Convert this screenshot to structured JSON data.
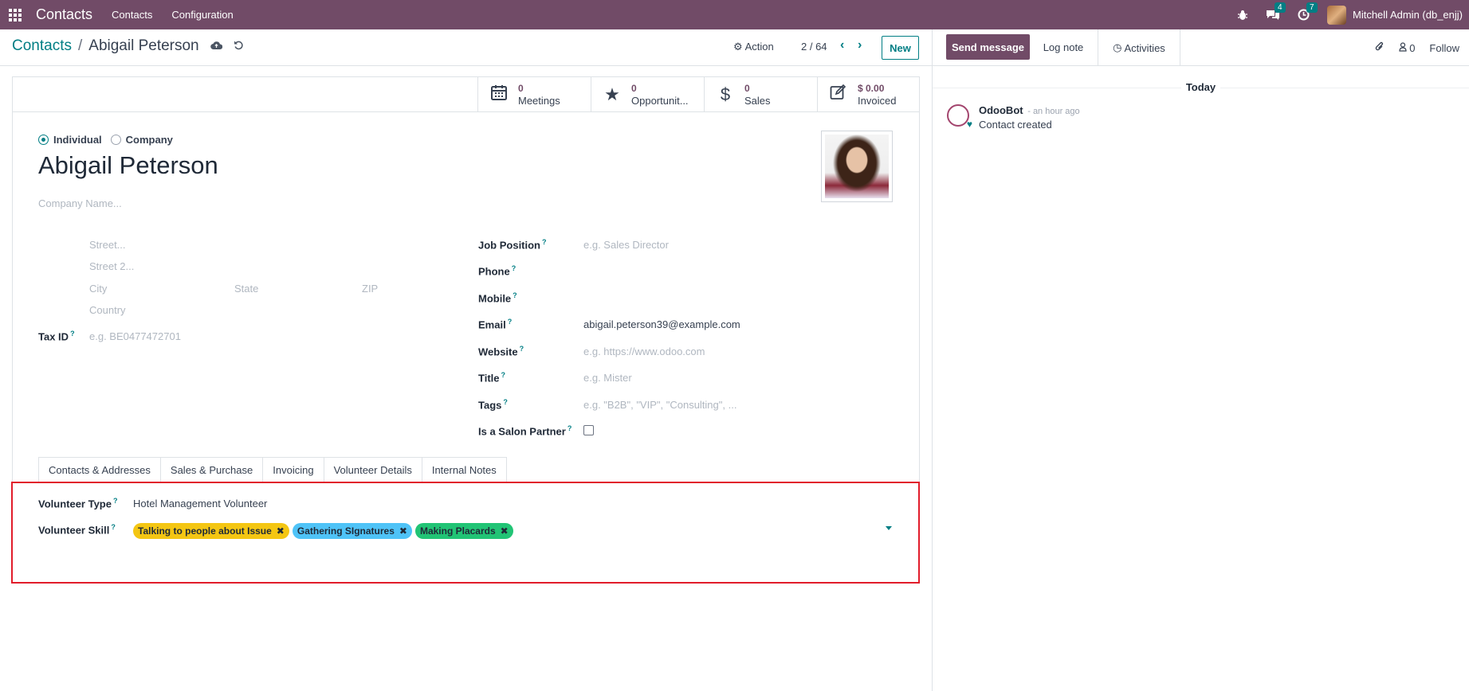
{
  "topbar": {
    "brand": "Contacts",
    "menu": [
      "Contacts",
      "Configuration"
    ],
    "messages_count": "4",
    "activities_count": "7",
    "user": "Mitchell Admin (db_enjj)"
  },
  "control_panel": {
    "breadcrumb_parent": "Contacts",
    "breadcrumb_current": "Abigail Peterson",
    "action_label": "Action",
    "pager": "2 / 64",
    "new_label": "New"
  },
  "smart_buttons": [
    {
      "value": "0",
      "label": "Meetings",
      "icon": "calendar-icon"
    },
    {
      "value": "0",
      "label": "Opportunit...",
      "icon": "star-icon"
    },
    {
      "value": "0",
      "label": "Sales",
      "icon": "dollar-icon"
    },
    {
      "value": "$ 0.00",
      "label": "Invoiced",
      "icon": "edit-icon"
    }
  ],
  "form": {
    "type_individual": "Individual",
    "type_company": "Company",
    "name": "Abigail Peterson",
    "company_placeholder": "Company Name...",
    "street_placeholder": "Street...",
    "street2_placeholder": "Street 2...",
    "city_placeholder": "City",
    "state_placeholder": "State",
    "zip_placeholder": "ZIP",
    "country_placeholder": "Country",
    "tax_label": "Tax ID",
    "tax_placeholder": "e.g. BE0477472701",
    "job_label": "Job Position",
    "job_placeholder": "e.g. Sales Director",
    "phone_label": "Phone",
    "mobile_label": "Mobile",
    "email_label": "Email",
    "email_value": "abigail.peterson39@example.com",
    "website_label": "Website",
    "website_placeholder": "e.g. https://www.odoo.com",
    "title_label": "Title",
    "title_placeholder": "e.g. Mister",
    "tags_label": "Tags",
    "tags_placeholder": "e.g. \"B2B\", \"VIP\", \"Consulting\", ...",
    "salon_label": "Is a Salon Partner",
    "help_mark": "?"
  },
  "tabs": [
    "Contacts & Addresses",
    "Sales & Purchase",
    "Invoicing",
    "Volunteer Details",
    "Internal Notes"
  ],
  "volunteer": {
    "type_label": "Volunteer Type",
    "type_value": "Hotel Management Volunteer",
    "skill_label": "Volunteer Skill",
    "skills": [
      "Talking to people about Issue",
      "Gathering SIgnatures",
      "Making Placards"
    ]
  },
  "chatter": {
    "send_message": "Send message",
    "log_note": "Log note",
    "activities": "Activities",
    "followers_count": "0",
    "follow": "Follow",
    "today": "Today",
    "author": "OdooBot",
    "time": "- an hour ago",
    "body": "Contact created"
  }
}
